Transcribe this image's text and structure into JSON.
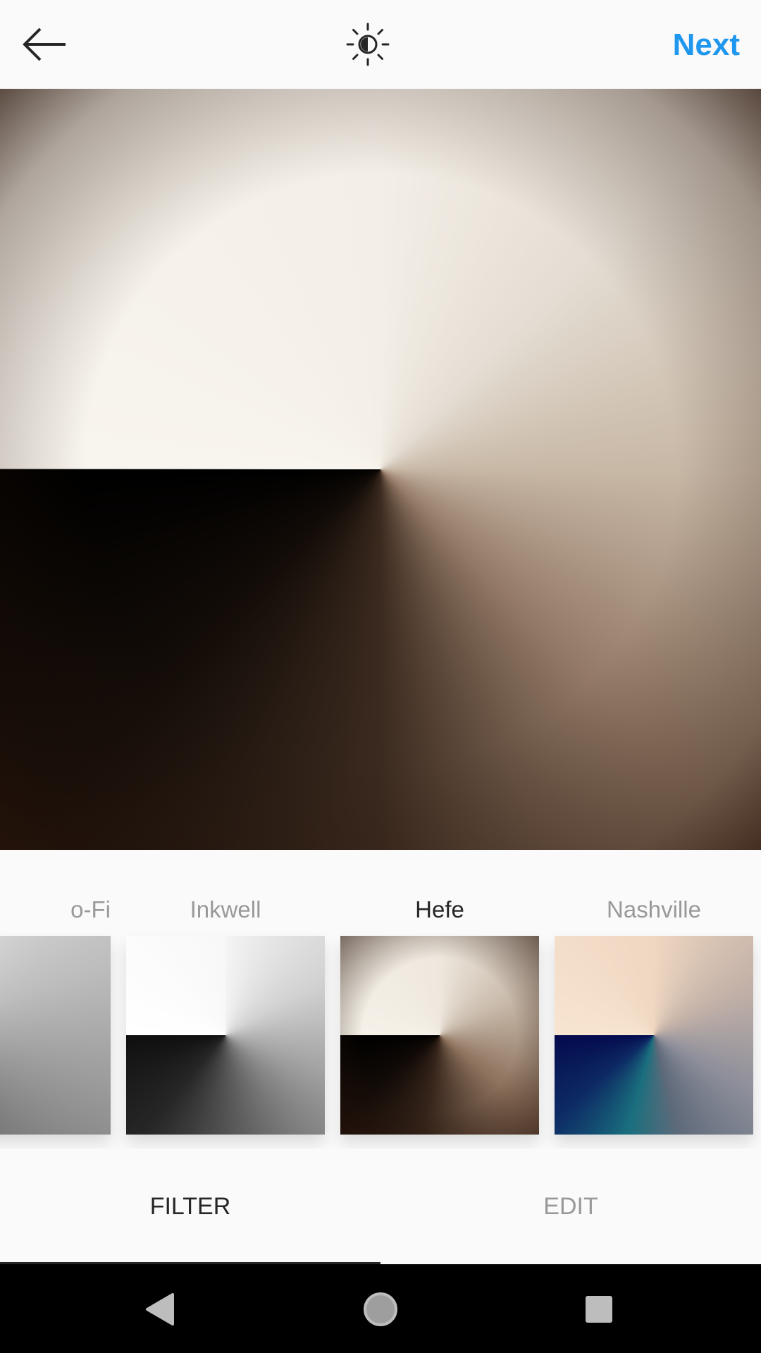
{
  "header": {
    "back_icon": "arrow-left-icon",
    "brightness_icon": "sun-contrast-icon",
    "next_label": "Next",
    "accent_color": "#1f97ef"
  },
  "preview": {
    "filter_applied": "Hefe"
  },
  "filters": [
    {
      "label": "o-Fi",
      "selected": false
    },
    {
      "label": "Inkwell",
      "selected": false
    },
    {
      "label": "Hefe",
      "selected": true
    },
    {
      "label": "Nashville",
      "selected": false
    }
  ],
  "tabs": {
    "filter_label": "FILTER",
    "edit_label": "EDIT",
    "active": "FILTER"
  },
  "system_nav": {
    "back_icon": "triangle-back-icon",
    "home_icon": "circle-home-icon",
    "recents_icon": "square-recents-icon"
  }
}
